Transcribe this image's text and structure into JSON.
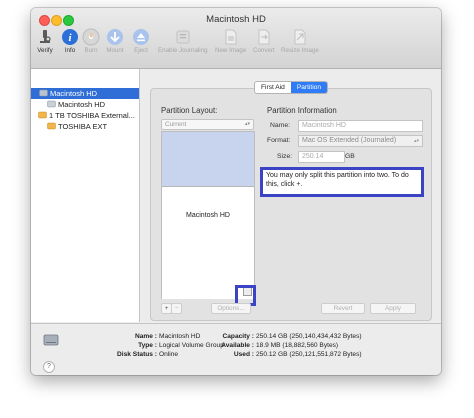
{
  "window": {
    "title": "Macintosh HD"
  },
  "toolbar": [
    {
      "label": "Verify",
      "icon": "microscope-icon",
      "enabled": true
    },
    {
      "label": "Info",
      "icon": "info-icon",
      "enabled": true
    },
    {
      "label": "Burn",
      "icon": "burn-disc-icon",
      "enabled": false
    },
    {
      "label": "Mount",
      "icon": "mount-icon",
      "enabled": false
    },
    {
      "label": "Eject",
      "icon": "eject-icon",
      "enabled": false
    },
    {
      "label": "Enable Journaling",
      "icon": "journal-icon",
      "enabled": false
    },
    {
      "label": "New Image",
      "icon": "new-image-icon",
      "enabled": false
    },
    {
      "label": "Convert",
      "icon": "convert-icon",
      "enabled": false
    },
    {
      "label": "Resize Image",
      "icon": "resize-image-icon",
      "enabled": false
    }
  ],
  "sidebar": {
    "items": [
      {
        "label": "Macintosh HD",
        "selected": true
      },
      {
        "label": "Macintosh HD",
        "selected": false
      },
      {
        "label": "1 TB TOSHIBA External...",
        "selected": false
      },
      {
        "label": "TOSHIBA EXT",
        "selected": false
      }
    ]
  },
  "tabs": [
    {
      "label": "First Aid",
      "active": false
    },
    {
      "label": "Partition",
      "active": true
    }
  ],
  "partition": {
    "layout_label": "Partition Layout:",
    "layout_value": "Current",
    "info_heading": "Partition Information",
    "name_label": "Name:",
    "name_value": "Macintosh HD",
    "format_label": "Format:",
    "format_value": "Mac OS Extended (Journaled)",
    "size_label": "Size:",
    "size_value": "250.14",
    "size_unit": "GB",
    "map_volume_label": "Macintosh HD",
    "note": "You may only split this partition into two. To do this, click +.",
    "plus_label": "+",
    "minus_label": "−",
    "options_label": "Options...",
    "revert_label": "Revert",
    "apply_label": "Apply"
  },
  "info": {
    "name_key": "Name :",
    "name_value": "Macintosh HD",
    "type_key": "Type :",
    "type_value": "Logical Volume Group",
    "status_key": "Disk Status :",
    "status_value": "Online",
    "capacity_key": "Capacity :",
    "capacity_value": "250.14 GB (250,140,434,432 Bytes)",
    "available_key": "Available :",
    "available_value": "18.9 MB (18,882,560 Bytes)",
    "used_key": "Used :",
    "used_value": "250.12 GB (250,121,551,872 Bytes)",
    "help_label": "?"
  },
  "colors": {
    "selection": "#2f6ed6",
    "segment_active": "#2f7cf6",
    "free_space": "#c8d3ee",
    "annotation": "#3c44c6"
  }
}
